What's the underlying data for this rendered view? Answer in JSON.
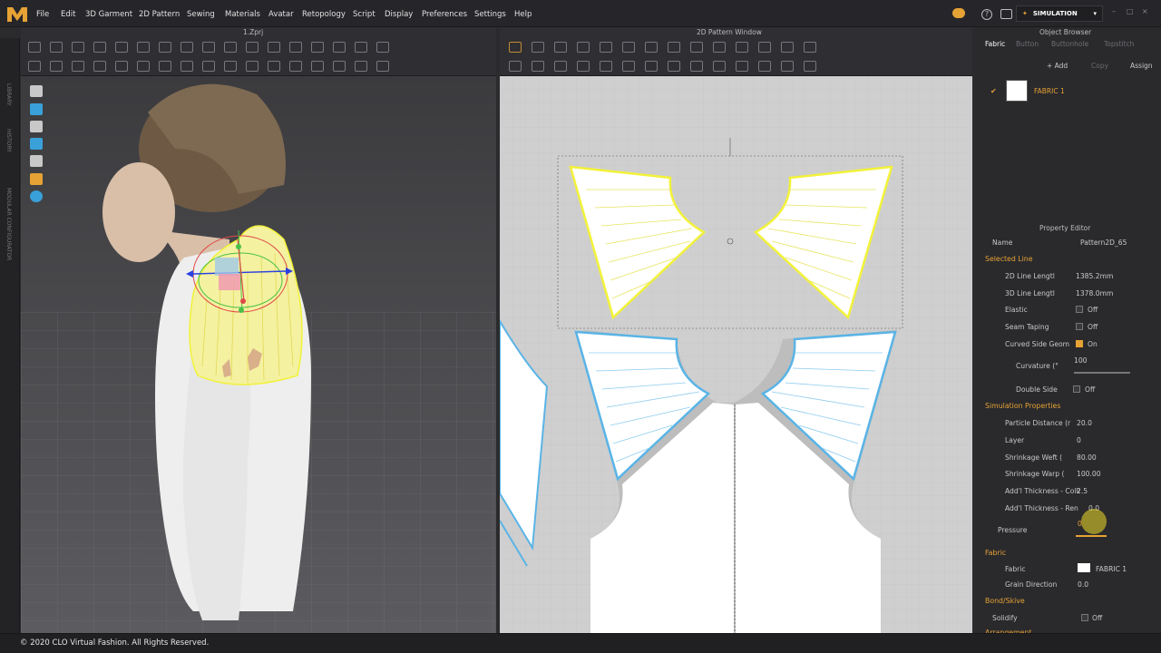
{
  "menu": [
    "File",
    "Edit",
    "3D Garment",
    "2D Pattern",
    "Sewing",
    "Materials",
    "Avatar",
    "Retopology",
    "Script",
    "Display",
    "Preferences",
    "Settings",
    "Help"
  ],
  "mode": "SIMULATION",
  "window3d": {
    "title": "1.Zprj"
  },
  "window2d": {
    "title": "2D Pattern Window"
  },
  "object_browser": {
    "title": "Object Browser",
    "tabs": [
      "Fabric",
      "Button",
      "Buttonhole",
      "Topstitch"
    ],
    "add_label": "+ Add",
    "copy_label": "Copy",
    "assign_label": "Assign",
    "fabric_item": "FABRIC 1"
  },
  "property_editor": {
    "title": "Property Editor",
    "name_label": "Name",
    "name_value": "Pattern2D_65",
    "selected_line": "Selected Line",
    "line_2d_label": "2D Line Lengtl",
    "line_2d_value": "1385.2mm",
    "line_3d_label": "3D Line Lengtl",
    "line_3d_value": "1378.0mm",
    "elastic_label": "Elastic",
    "elastic_value": "Off",
    "seam_taping_label": "Seam Taping",
    "seam_taping_value": "Off",
    "curved_label": "Curved Side Geom",
    "curved_value": "On",
    "curvature_label": "Curvature (°",
    "curvature_value": "100",
    "double_side_label": "Double Side",
    "double_side_value": "Off",
    "sim_props": "Simulation Properties",
    "particle_label": "Particle Distance (r",
    "particle_value": "20.0",
    "layer_label": "Layer",
    "layer_value": "0",
    "shrink_weft_label": "Shrinkage Weft (",
    "shrink_weft_value": "80.00",
    "shrink_warp_label": "Shrinkage Warp (",
    "shrink_warp_value": "100.00",
    "add_thick_coll_label": "Add'l Thickness - Colli",
    "add_thick_coll_value": "2.5",
    "add_thick_ren_label": "Add'l Thickness - Ren",
    "add_thick_ren_value": "0.0",
    "pressure_label": "Pressure",
    "pressure_value": "0",
    "fabric_section": "Fabric",
    "fabric_label": "Fabric",
    "fabric_value": "FABRIC 1",
    "grain_label": "Grain Direction",
    "grain_value": "0.0",
    "bond_label": "Bond/Skive",
    "solidify_label": "Solidify",
    "solidify_value": "Off",
    "arrangement_label": "Arrangement"
  },
  "side_tabs": {
    "library": "LIBRARY",
    "history": "HISTORY",
    "modular": "MODULAR CONFIGURATOR"
  },
  "footer": {
    "copyright": "© 2020 CLO Virtual Fashion. All Rights Reserved."
  },
  "colors": {
    "accent": "#e6a234",
    "selected_yellow": "#f2f23a",
    "pattern_blue": "#5ab4e6",
    "canvas_gray": "#cfcfcf"
  },
  "icons": [
    "clo-logo-icon",
    "cloud-icon",
    "help-icon",
    "settings-icon",
    "gear-icon",
    "minimize-icon",
    "maximize-icon",
    "close-icon"
  ]
}
